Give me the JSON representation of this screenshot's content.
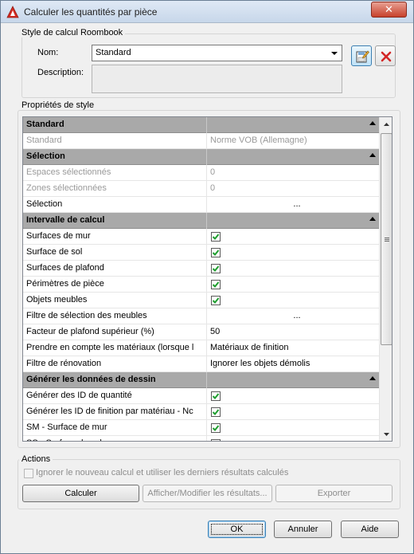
{
  "window": {
    "title": "Calculer les quantités par pièce",
    "close_label": "✕"
  },
  "style_group": {
    "label": "Style de calcul Roombook",
    "name_label": "Nom:",
    "name_value": "Standard",
    "description_label": "Description:",
    "description_value": ""
  },
  "properties": {
    "label": "Propriétés de style",
    "rows": [
      {
        "type": "category",
        "name": "Standard"
      },
      {
        "type": "disabled",
        "name": "Standard",
        "value": "Norme VOB (Allemagne)"
      },
      {
        "type": "category",
        "name": "Sélection"
      },
      {
        "type": "disabled",
        "name": "Espaces sélectionnés",
        "value": "0"
      },
      {
        "type": "disabled",
        "name": "Zones sélectionnées",
        "value": "0"
      },
      {
        "type": "ellipsis",
        "name": "Sélection",
        "value": "..."
      },
      {
        "type": "category",
        "name": "Intervalle de calcul"
      },
      {
        "type": "check",
        "name": "Surfaces de mur",
        "checked": true
      },
      {
        "type": "check",
        "name": "Surface de sol",
        "checked": true
      },
      {
        "type": "check",
        "name": "Surfaces de plafond",
        "checked": true
      },
      {
        "type": "check",
        "name": "Périmètres de pièce",
        "checked": true
      },
      {
        "type": "check",
        "name": "Objets meubles",
        "checked": true
      },
      {
        "type": "ellipsis",
        "name": "Filtre de sélection des meubles",
        "value": "..."
      },
      {
        "type": "text",
        "name": "Facteur de plafond supérieur (%)",
        "value": "50"
      },
      {
        "type": "text",
        "name": "Prendre en compte les matériaux (lorsque l",
        "value": "Matériaux de finition"
      },
      {
        "type": "text",
        "name": "Filtre de rénovation",
        "value": "Ignorer les objets démolis"
      },
      {
        "type": "category",
        "name": "Générer les données de dessin"
      },
      {
        "type": "check",
        "name": "Générer des ID de quantité",
        "checked": true
      },
      {
        "type": "check",
        "name": "Générer les ID de finition par matériau - Nc",
        "checked": true
      },
      {
        "type": "check",
        "name": "SM - Surface de mur",
        "checked": true
      },
      {
        "type": "check",
        "name": "SS - Surface de sol",
        "checked": true
      }
    ]
  },
  "actions": {
    "label": "Actions",
    "checkbox_label": "Ignorer le nouveau calcul et utiliser les derniers résultats calculés",
    "checkbox_checked": false,
    "calculate": "Calculer",
    "show_modify": "Afficher/Modifier les résultats...",
    "export": "Exporter"
  },
  "footer": {
    "ok": "OK",
    "cancel": "Annuler",
    "help": "Aide"
  }
}
